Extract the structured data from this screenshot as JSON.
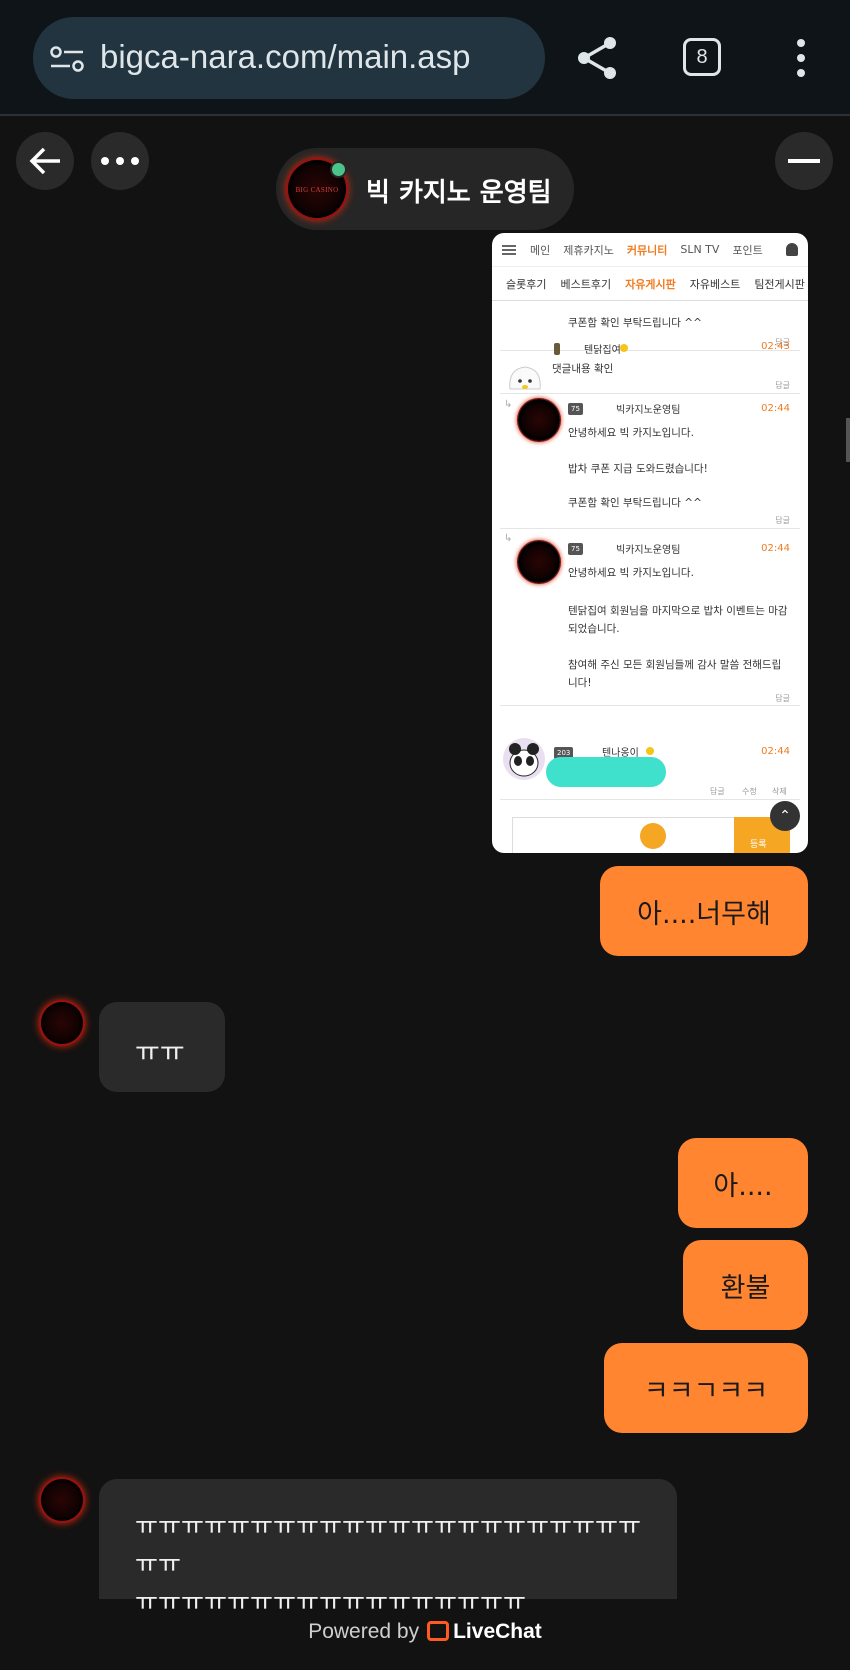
{
  "browser": {
    "url": "bigca-nara.com/main.asp",
    "tab_count": "8"
  },
  "chat": {
    "agent_name": "빅 카지노 운영팀",
    "logo_text": "BIG CASINO"
  },
  "screenshot": {
    "top_nav": [
      "메인",
      "제휴카지노",
      "커뮤니티",
      "SLN TV",
      "포인트"
    ],
    "active_top": "커뮤니티",
    "sub_nav": [
      "슬롯후기",
      "베스트후기",
      "자유게시판",
      "자유베스트",
      "팀전게시판"
    ],
    "active_sub": "자유게시판",
    "c0_text": "쿠폰함 확인 부탁드립니다 ^^",
    "reply": "답글",
    "c1_user": "텐닭집여",
    "c1_time": "02:43",
    "c1_text": "댓글내용 확인",
    "c2_level": "75",
    "c2_user": "빅카지노운영팀",
    "c2_time": "02:44",
    "c2_l1": "안녕하세요 빅 카지노입니다.",
    "c2_l2": "밥차 쿠폰 지급 도와드렸습니다!",
    "c2_l3": "쿠폰함 확인 부탁드립니다 ^^",
    "c3_level": "75",
    "c3_user": "빅카지노운영팀",
    "c3_time": "02:44",
    "c3_l1": "안녕하세요 빅 카지노입니다.",
    "c3_l2": "텐닭집여 회원님을 마지막으로 밥차 이벤트는 마감",
    "c3_l3": "되었습니다.",
    "c3_l4": "참여해 주신 모든 회원님들께 감사 말씀 전해드립",
    "c3_l5": "니다!",
    "c4_level": "203",
    "c4_user": "텐나옹이",
    "c4_time": "02:44",
    "c4_actions": [
      "답글",
      "수정",
      "삭제"
    ],
    "input_button": "등록"
  },
  "messages": {
    "m1": "아....너무해",
    "m2": "ㅠㅠ",
    "m3": "아....",
    "m4": "환불",
    "m5": "ㅋㅋㄱㅋㅋ",
    "m6": "ㅠㅠㅠㅠㅠㅠㅠㅠㅠㅠㅠㅠㅠㅠㅠㅠㅠㅠㅠㅠㅠㅠㅠㅠ\nㅠㅠㅠㅠㅠㅠㅠㅠㅠㅠㅠㅠㅠㅠㅠㅠㅠ"
  },
  "footer": {
    "powered_by": "Powered by",
    "brand": "LiveChat"
  },
  "colors": {
    "accent_orange": "#ff8530",
    "online_green": "#4cc38a",
    "background": "#121212"
  }
}
